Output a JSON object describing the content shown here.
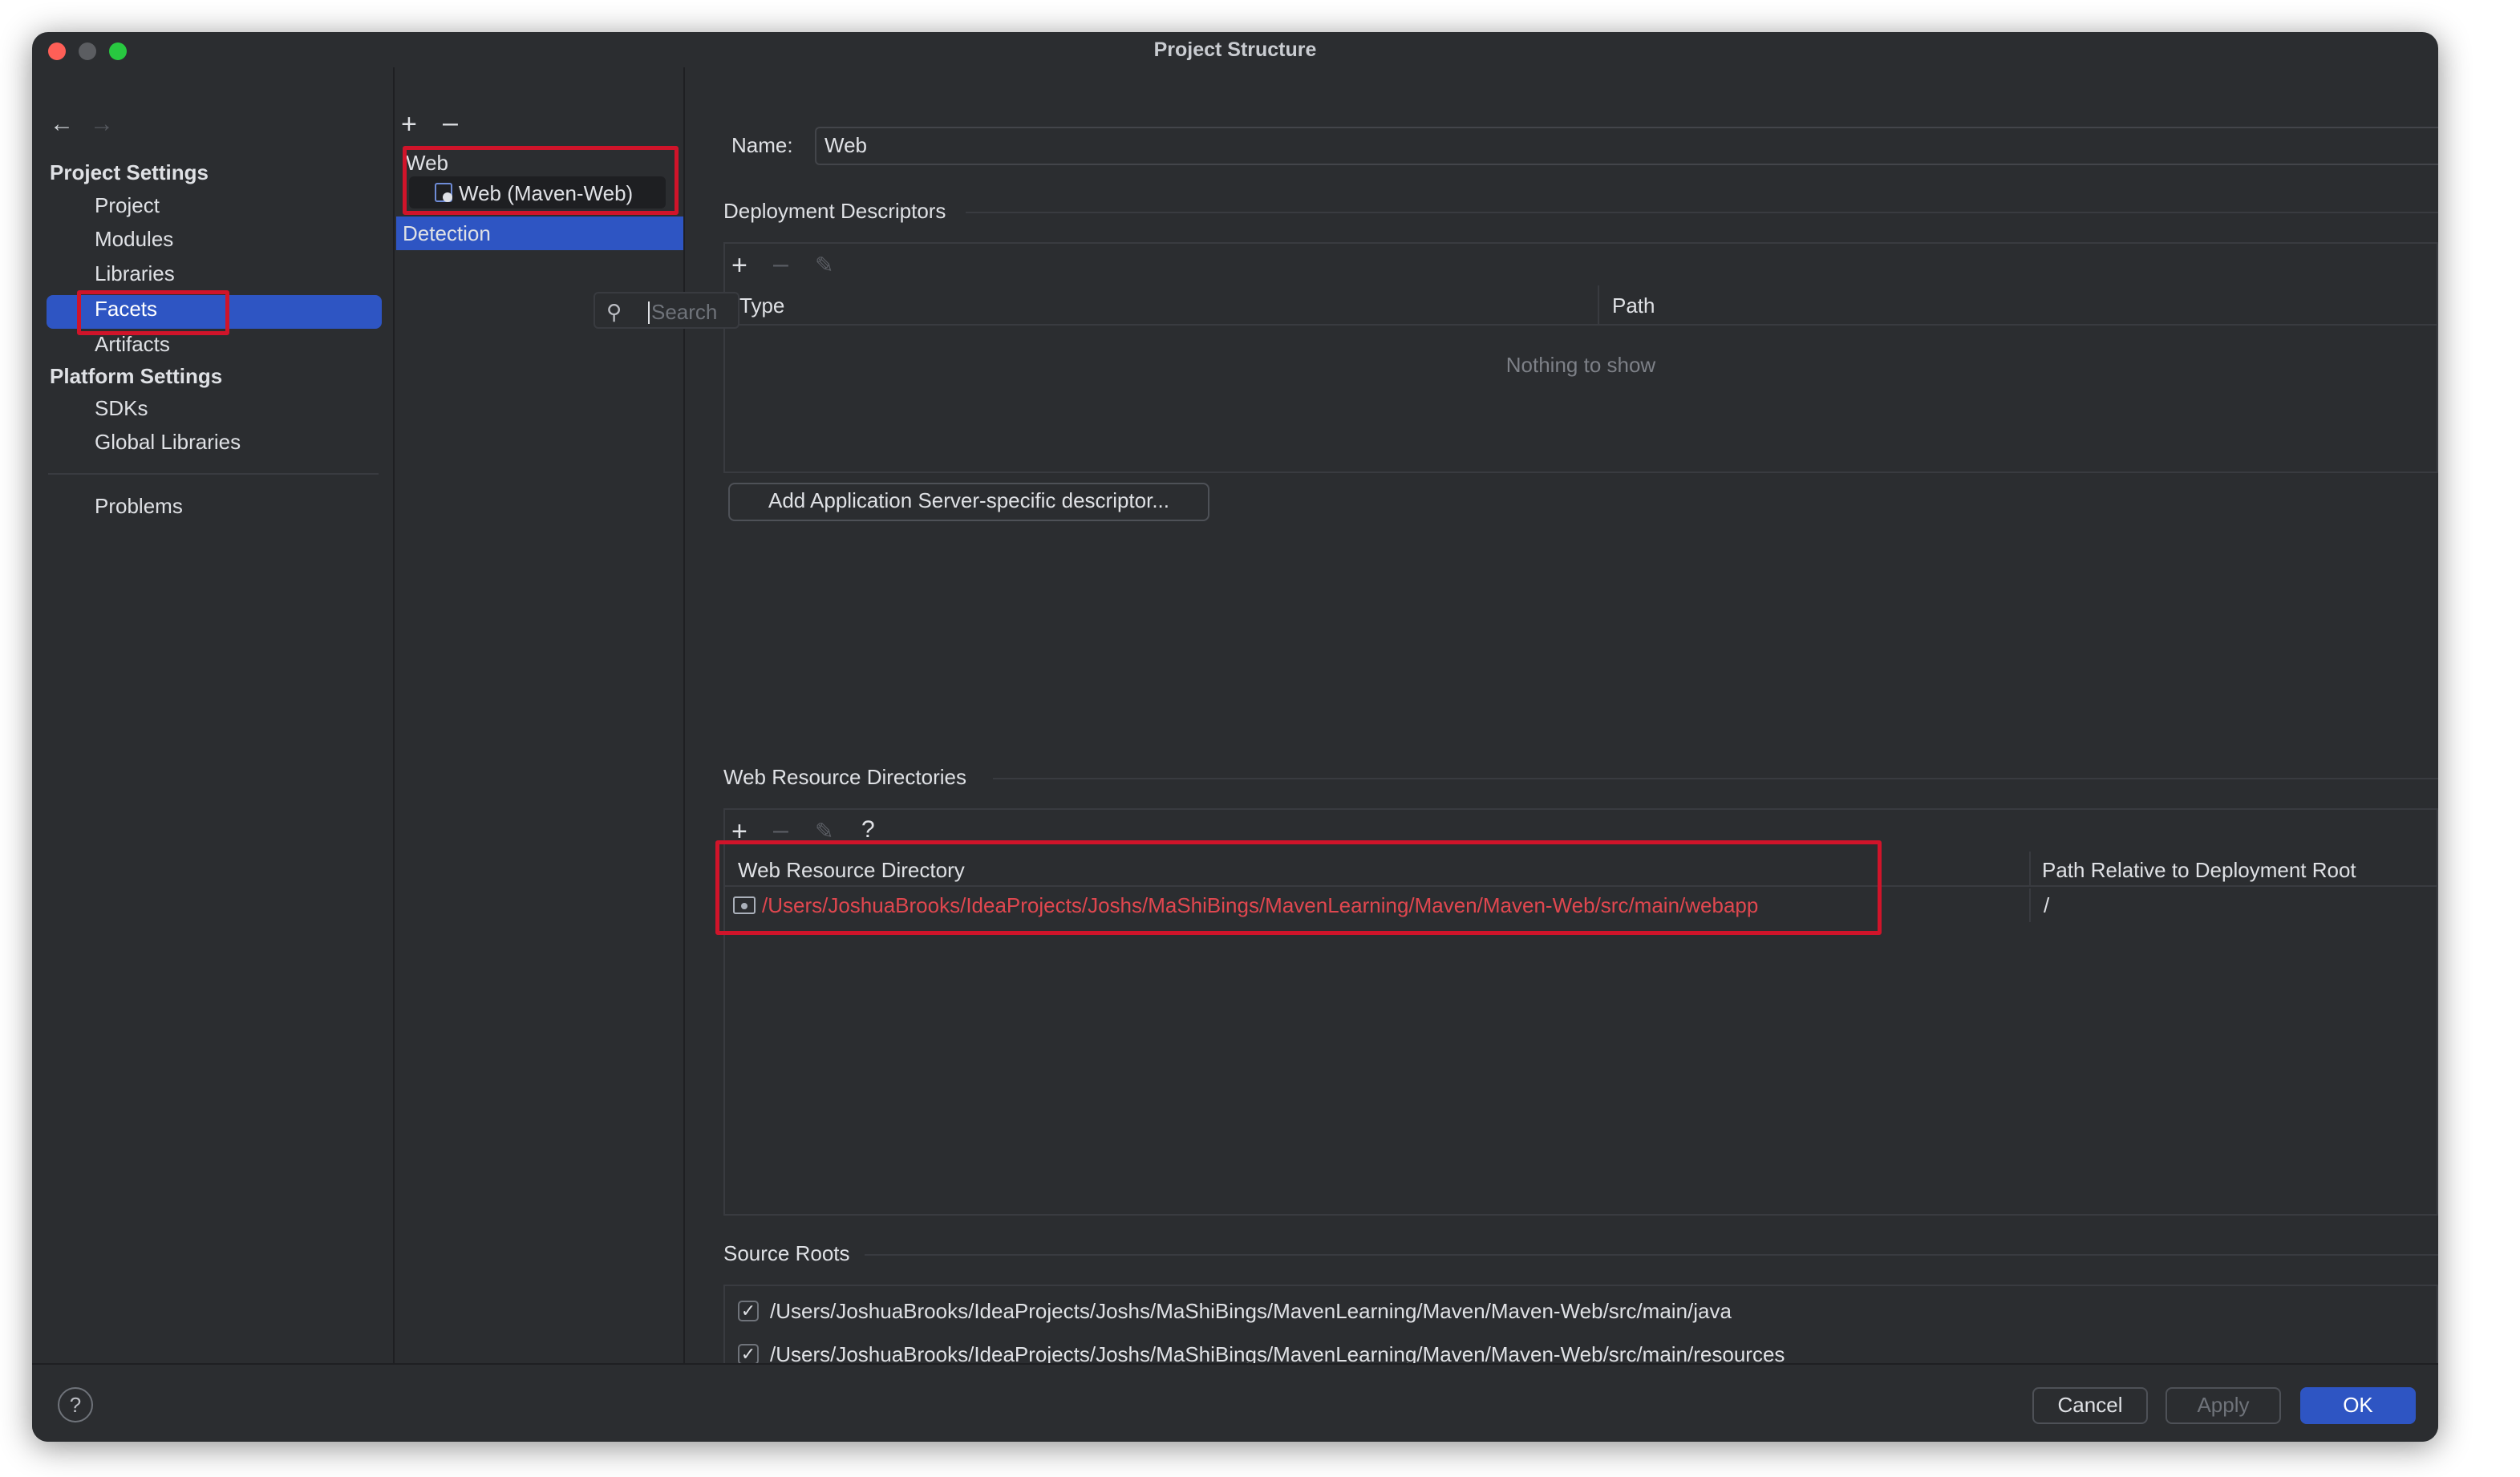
{
  "window": {
    "title": "Project Structure"
  },
  "sidebar": {
    "project_settings_header": "Project Settings",
    "project_settings_items": [
      "Project",
      "Modules",
      "Libraries",
      "Facets",
      "Artifacts"
    ],
    "platform_settings_header": "Platform Settings",
    "platform_settings_items": [
      "SDKs",
      "Global Libraries"
    ],
    "problems": "Problems"
  },
  "middle": {
    "tree_root": "Web",
    "tree_child": "Web (Maven-Web)",
    "detection": "Detection",
    "search_placeholder": "Search"
  },
  "facet": {
    "name_label": "Name:",
    "name_value": "Web",
    "deployment_descriptors_title": "Deployment Descriptors",
    "dd_columns": [
      "Type",
      "Path"
    ],
    "dd_empty": "Nothing to show",
    "add_descriptor_button": "Add Application Server-specific descriptor...",
    "web_resource_title": "Web Resource Directories",
    "wr_help": "?",
    "wr_columns": [
      "Web Resource Directory",
      "Path Relative to Deployment Root"
    ],
    "wr_rows": [
      {
        "directory": "/Users/JoshuaBrooks/IdeaProjects/Joshs/MaShiBings/MavenLearning/Maven/Maven-Web/src/main/webapp",
        "relative": "/"
      }
    ],
    "source_roots_title": "Source Roots",
    "source_roots": [
      "/Users/JoshuaBrooks/IdeaProjects/Joshs/MaShiBings/MavenLearning/Maven/Maven-Web/src/main/java",
      "/Users/JoshuaBrooks/IdeaProjects/Joshs/MaShiBings/MavenLearning/Maven/Maven-Web/src/main/resources"
    ]
  },
  "footer": {
    "help": "?",
    "cancel": "Cancel",
    "apply": "Apply",
    "ok": "OK"
  },
  "colors": {
    "accent": "#2e55c3",
    "error_path": "#e0474f",
    "highlight_box": "#d0142a",
    "background": "#2b2d30"
  }
}
